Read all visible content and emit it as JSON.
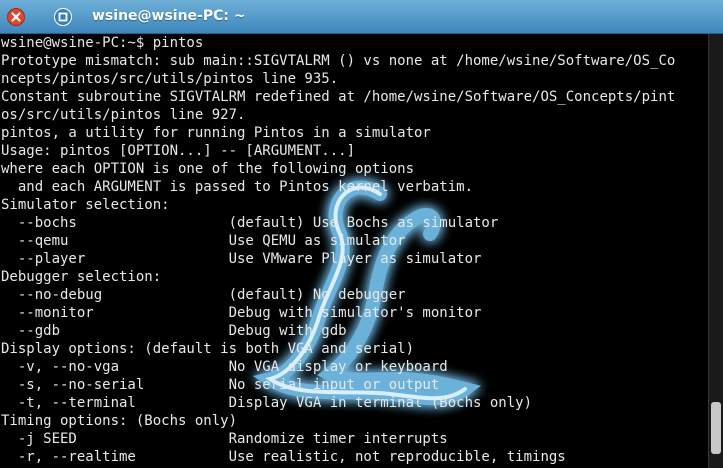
{
  "window": {
    "title": "wsine@wsine-PC: ~",
    "close_icon": "close-icon",
    "maximize_icon": "maximize-icon",
    "colors": {
      "titlebar": "#4b93c6",
      "close": "#e0452e",
      "background": "#000000",
      "text": "#e8e8e8"
    }
  },
  "terminal": {
    "lines": [
      "wsine@wsine-PC:~$ pintos",
      "Prototype mismatch: sub main::SIGVTALRM () vs none at /home/wsine/Software/OS_Co",
      "ncepts/pintos/src/utils/pintos line 935.",
      "Constant subroutine SIGVTALRM redefined at /home/wsine/Software/OS_Concepts/pint",
      "os/src/utils/pintos line 927.",
      "pintos, a utility for running Pintos in a simulator",
      "Usage: pintos [OPTION...] -- [ARGUMENT...]",
      "where each OPTION is one of the following options",
      "  and each ARGUMENT is passed to Pintos kernel verbatim.",
      "Simulator selection:",
      "  --bochs                  (default) Use Bochs as simulator",
      "  --qemu                   Use QEMU as simulator",
      "  --player                 Use VMware Player as simulator",
      "Debugger selection:",
      "  --no-debug               (default) No debugger",
      "  --monitor                Debug with simulator's monitor",
      "  --gdb                    Debug with gdb",
      "Display options: (default is both VGA and serial)",
      "  -v, --no-vga             No VGA display or keyboard",
      "  -s, --no-serial          No serial input or output",
      "  -t, --terminal           Display VGA in terminal (Bochs only)",
      "Timing options: (Bochs only)",
      "  -j SEED                  Randomize timer interrupts",
      "  -r, --realtime           Use realistic, not reproducible, timings"
    ]
  }
}
